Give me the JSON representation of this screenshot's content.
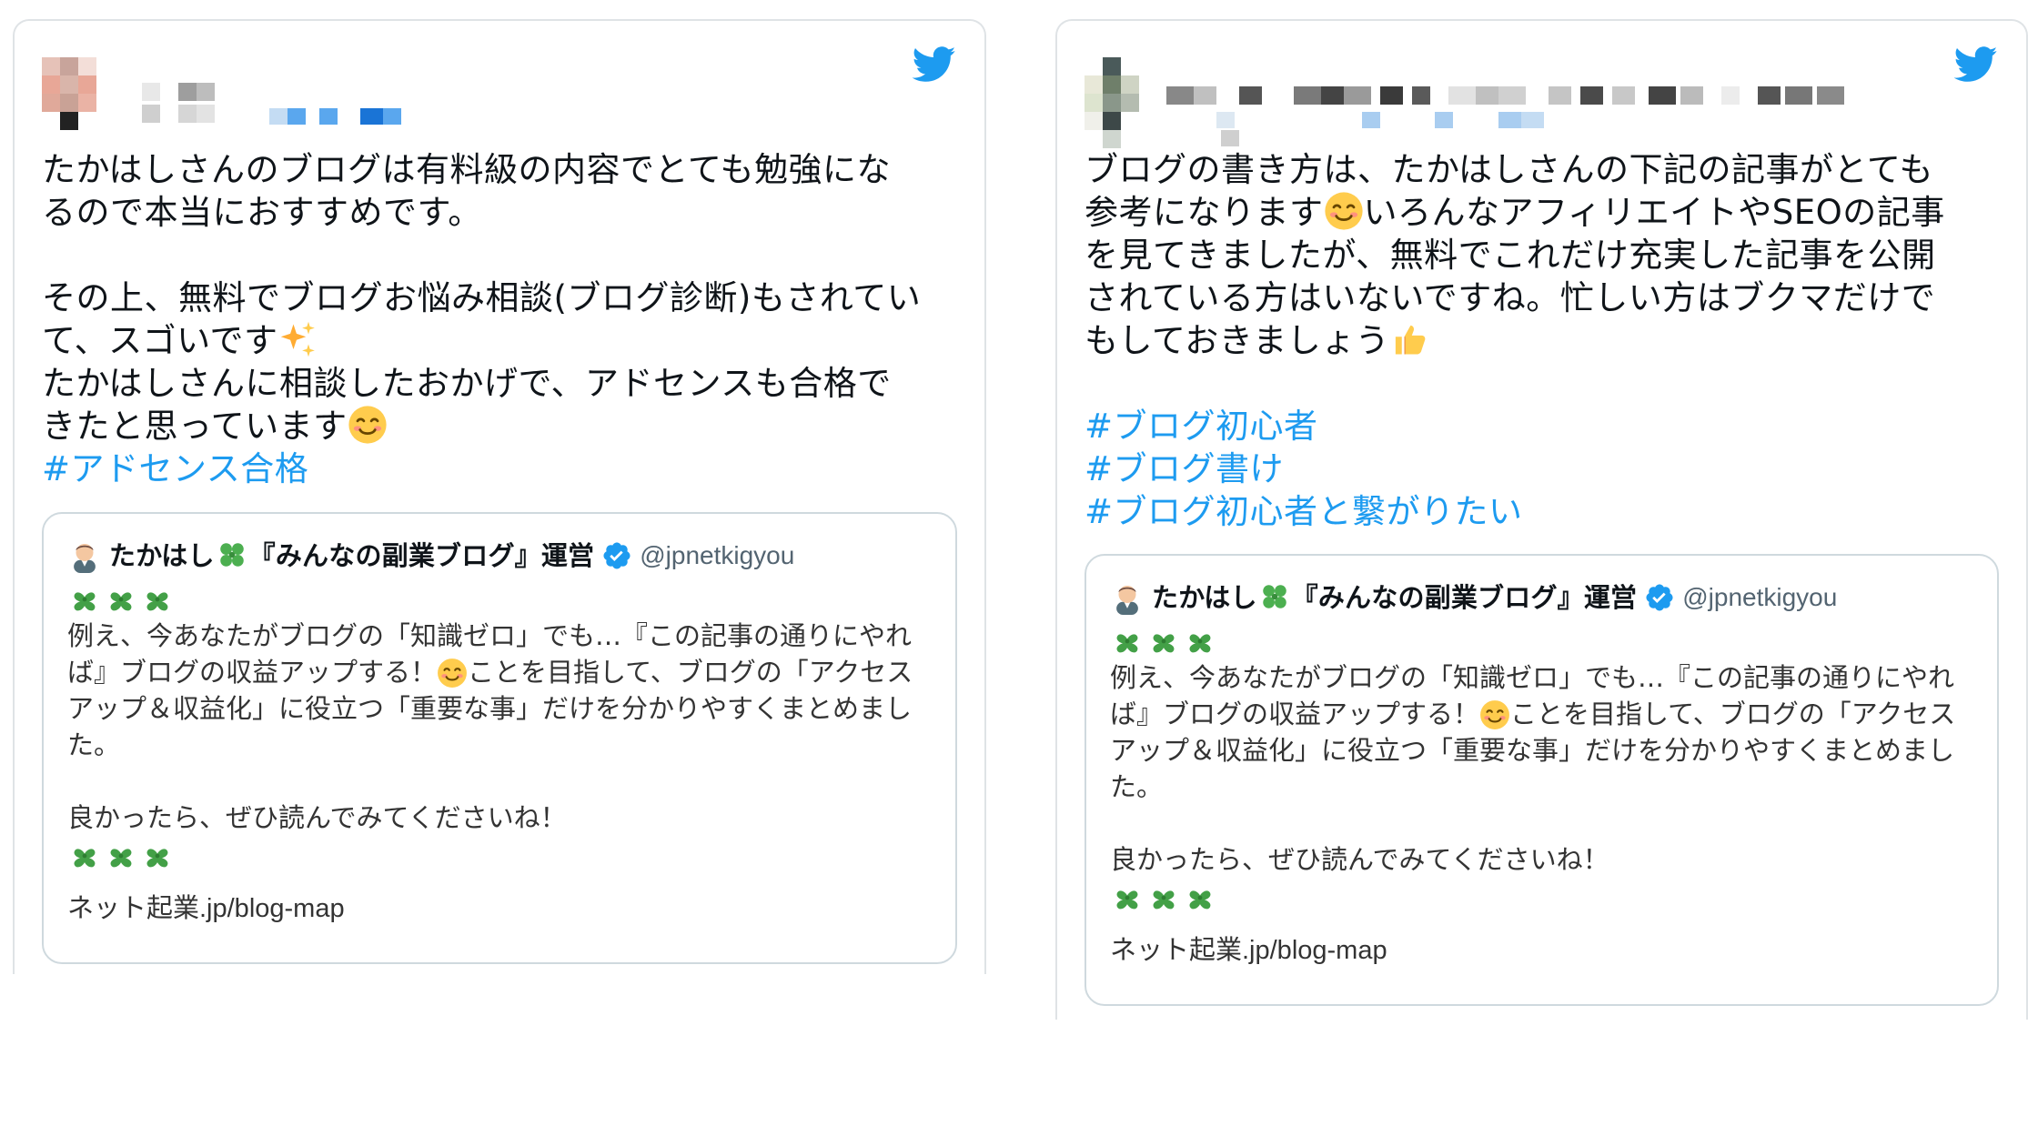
{
  "tweets": [
    {
      "body_lines": [
        "たかはしさんのブログは有料級の内容でとても勉強にな",
        "るので本当におすすめです。",
        "",
        "その上、無料でブログお悩み相談(ブログ診断)もされてい",
        "て、スゴいです",
        "たかはしさんに相談したおかげで、アドセンスも合格で",
        "きたと思っています"
      ],
      "hashtags": [
        "#アドセンス合格"
      ],
      "quote": {
        "name_prefix": "たかはし",
        "name_suffix": "『みんなの副業ブログ』運営",
        "handle": "@jpnetkigyou",
        "text_line1": "例え、今あなたがブログの「知識ゼロ」でも…『この記事の通りにやれ",
        "text_line2a": "ば』ブログの収益アップする！",
        "text_line2b": "ことを目指して、ブログの「アクセス",
        "text_line3": "アップ＆収益化」に役立つ「重要な事」だけを分かりやすくまとめまし",
        "text_line4": "た。",
        "text_line5": "良かったら、ぜひ読んでみてくださいね！",
        "link": "ネット起業.jp/blog-map"
      }
    },
    {
      "body_lines": [
        "ブログの書き方は、たかはしさんの下記の記事がとても",
        "参考になります",
        "いろんなアフィリエイトやSEOの記事",
        "を見てきましたが、無料でこれだけ充実した記事を公開",
        "されている方はいないですね。忙しい方はブクマだけで",
        "もしておきましょう"
      ],
      "hashtags": [
        "#ブログ初心者",
        "#ブログ書け",
        "#ブログ初心者と繋がりたい"
      ],
      "quote": {
        "name_prefix": "たかはし",
        "name_suffix": "『みんなの副業ブログ』運営",
        "handle": "@jpnetkigyou",
        "text_line1": "例え、今あなたがブログの「知識ゼロ」でも…『この記事の通りにやれ",
        "text_line2a": "ば』ブログの収益アップする！",
        "text_line2b": "ことを目指して、ブログの「アクセス",
        "text_line3": "アップ＆収益化」に役立つ「重要な事」だけを分かりやすくまとめまし",
        "text_line4": "た。",
        "text_line5": "良かったら、ぜひ読んでみてくださいね！",
        "link": "ネット起業.jp/blog-map"
      }
    }
  ],
  "colors": {
    "hashtag": "#1d9bf0",
    "twitter_blue": "#1d9bf0",
    "clover_green": "#43a047",
    "border": "#cfd9de"
  },
  "icons": [
    "twitter-bird-icon",
    "verified-badge-icon",
    "clover-icon",
    "smiling-face-emoji",
    "sparkles-emoji",
    "thumbs-up-emoji"
  ]
}
